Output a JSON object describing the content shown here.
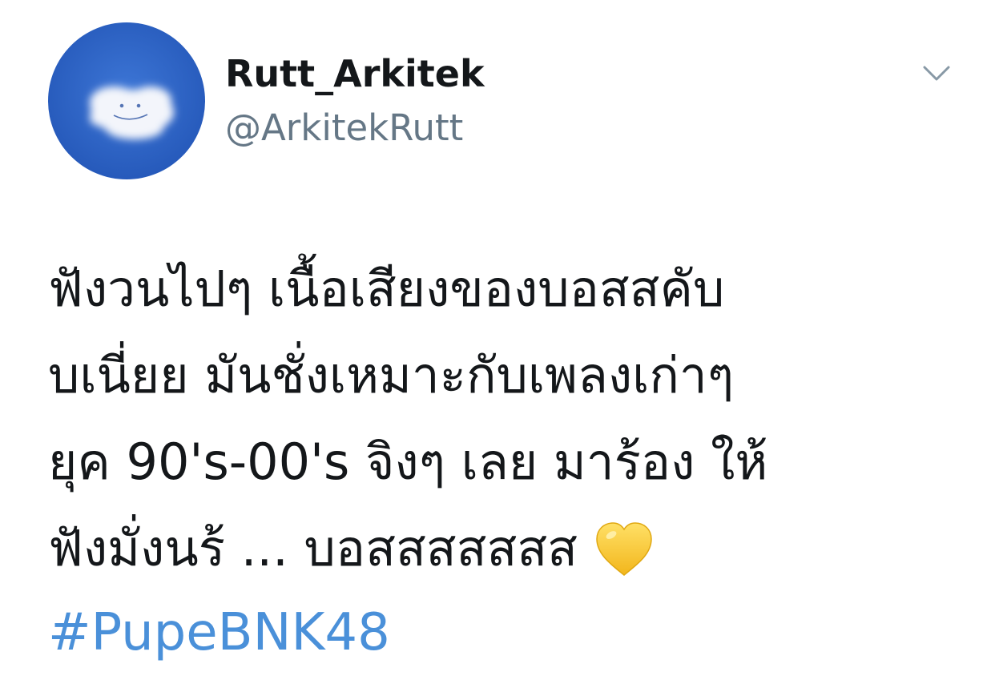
{
  "user": {
    "display_name": "Rutt_Arkitek",
    "handle": "@ArkitekRutt",
    "avatar_icon": "cloud-smiley-avatar"
  },
  "menu": {
    "icon": "chevron-down-icon"
  },
  "tweet": {
    "lines": [
      "ฟังวนไปๆ เนื้อเสียงของบอสสคับ",
      "บเนี่ยย มันชั่งเหมาะกับเพลงเก่าๆ",
      "ยุค 90's-00's จิงๆ เลย มาร้อง ให้",
      "ฟังมั่งนร้ ... บอสสสสสสส"
    ],
    "emoji": "yellow-heart-icon",
    "hashtag": "#PupeBNK48"
  },
  "colors": {
    "text": "#14171a",
    "secondary": "#657786",
    "link": "#4a90d9",
    "avatar_sky": "#2e63c4",
    "heart": "#f7c52e"
  }
}
